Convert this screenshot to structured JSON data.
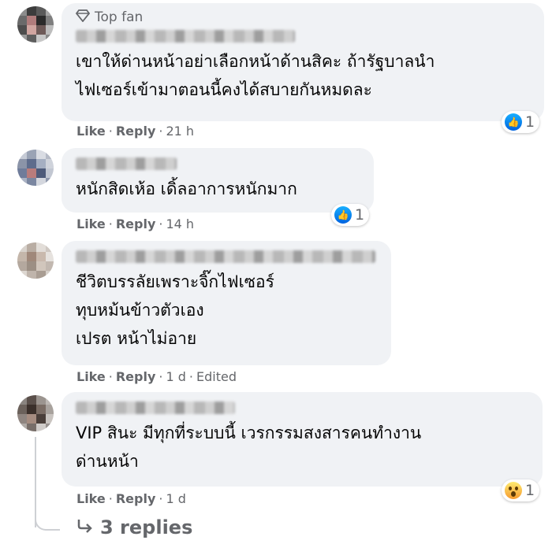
{
  "comments": [
    {
      "badge": "Top fan",
      "lines": [
        "เขาให้ด่านหน้าอย่าเลือกหน้าด้านสิคะ ถ้ารัฐบาลนำ",
        "ไฟเซอร์เข้ามาตอนนี้คงได้สบายกันหมดละ"
      ],
      "like": "Like",
      "reply": "Reply",
      "time": "21 h",
      "edited": "",
      "reaction_icon": "like-icon",
      "reaction_count": "1"
    },
    {
      "badge": "",
      "lines": [
        "หนักสิดเห้อ เดิ้ลอาการหนักมาก"
      ],
      "like": "Like",
      "reply": "Reply",
      "time": "14 h",
      "edited": "",
      "reaction_icon": "like-icon",
      "reaction_count": "1"
    },
    {
      "badge": "",
      "lines": [
        "ชีวิตบรรลัยเพราะจิ๊กไฟเซอร์",
        "ทุบหม้นข้าวตัวเอง",
        "เปรต หน้าไม่อาย"
      ],
      "like": "Like",
      "reply": "Reply",
      "time": "1 d",
      "edited": "Edited",
      "reaction_icon": "",
      "reaction_count": ""
    },
    {
      "badge": "",
      "lines": [
        "VIP สินะ มีทุกที่ระบบนี้ เวรกรรมสงสารคนทำงาน",
        "ด่านหน้า"
      ],
      "like": "Like",
      "reply": "Reply",
      "time": "1 d",
      "edited": "",
      "reaction_icon": "wow-icon",
      "reaction_count": "1"
    }
  ],
  "replies_label": "3 replies",
  "sep": "·",
  "colors": {
    "bubble": "#f0f2f5",
    "meta": "#65676b",
    "like_blue": "#0062df"
  }
}
